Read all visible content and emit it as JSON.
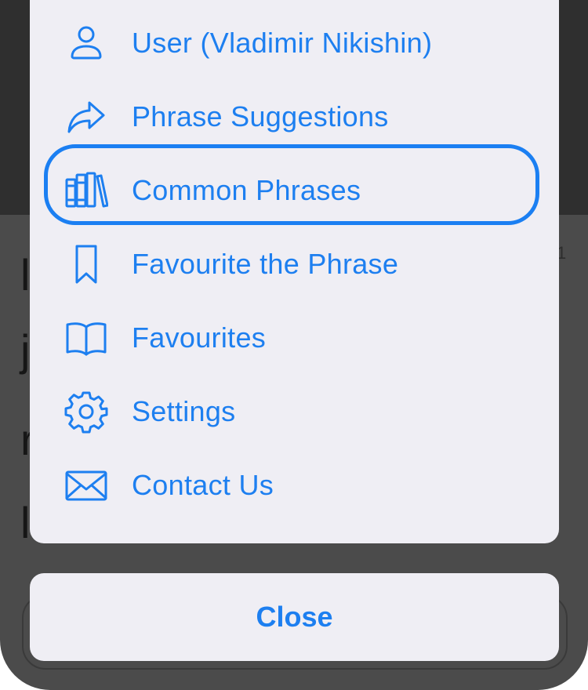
{
  "background": {
    "glyphs": [
      "j",
      "r",
      "l",
      "1",
      "l"
    ]
  },
  "action_sheet": {
    "items": [
      {
        "label": "User (Vladimir Nikishin)",
        "icon": "user-icon"
      },
      {
        "label": "Phrase Suggestions",
        "icon": "share-arrow-icon"
      },
      {
        "label": "Common Phrases",
        "icon": "books-icon"
      },
      {
        "label": "Favourite the Phrase",
        "icon": "bookmark-icon"
      },
      {
        "label": "Favourites",
        "icon": "open-book-icon"
      },
      {
        "label": "Settings",
        "icon": "gear-icon"
      },
      {
        "label": "Contact Us",
        "icon": "envelope-icon"
      }
    ],
    "focused_item": "Common Phrases",
    "close_label": "Close"
  },
  "colors": {
    "accent": "#1d7ff0",
    "sheet_bg": "#efeef4",
    "dim_bg": "#4b4b4b"
  }
}
